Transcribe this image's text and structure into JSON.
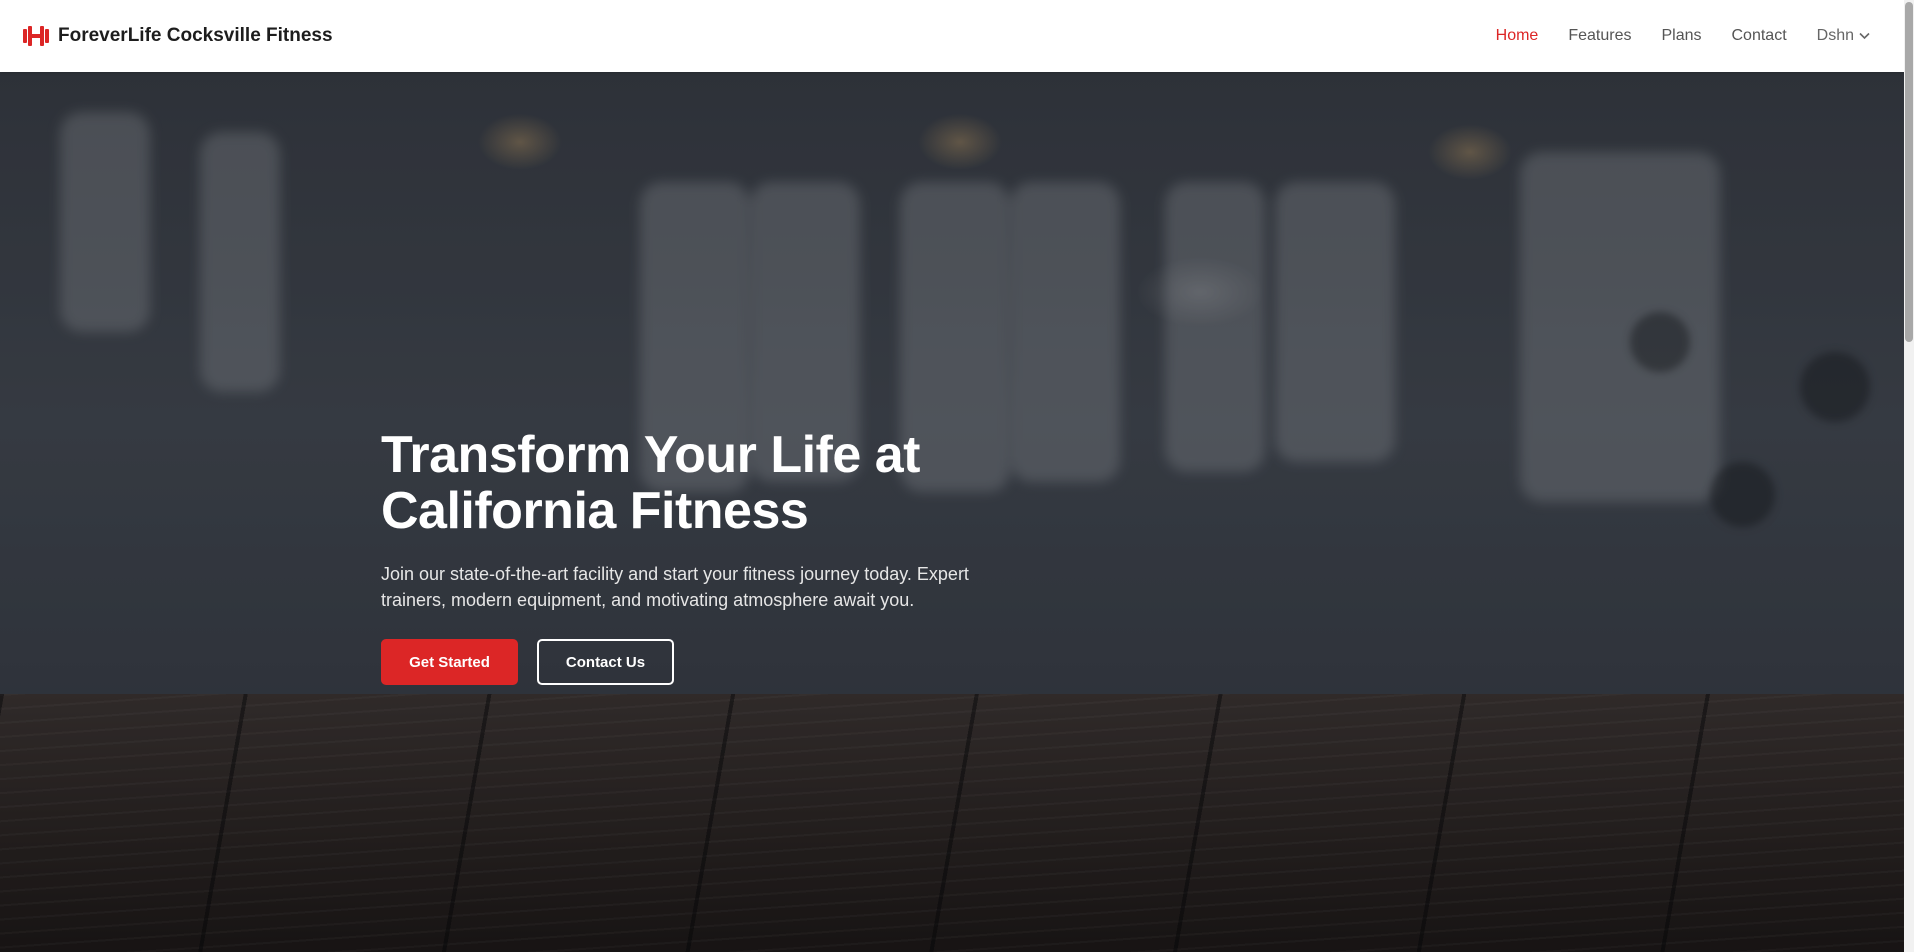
{
  "navbar": {
    "brand_name": "ForeverLife Cocksville Fitness",
    "brand_icon": "dumbbell-icon",
    "links": [
      {
        "label": "Home",
        "active": true
      },
      {
        "label": "Features",
        "active": false
      },
      {
        "label": "Plans",
        "active": false
      },
      {
        "label": "Contact",
        "active": false
      }
    ],
    "user": {
      "label": "Dshn",
      "icon": "chevron-down-icon"
    }
  },
  "hero": {
    "title_line1": "Transform Your Life at",
    "title_line2": "California Fitness",
    "subtitle": "Join our state-of-the-art facility and start your fitness journey today. Expert trainers, modern equipment, and motivating atmosphere await you.",
    "primary_button": "Get Started",
    "secondary_button": "Contact Us"
  },
  "colors": {
    "accent": "#dc2626",
    "navbar_bg": "#ffffff",
    "active_link": "#dc2626"
  }
}
